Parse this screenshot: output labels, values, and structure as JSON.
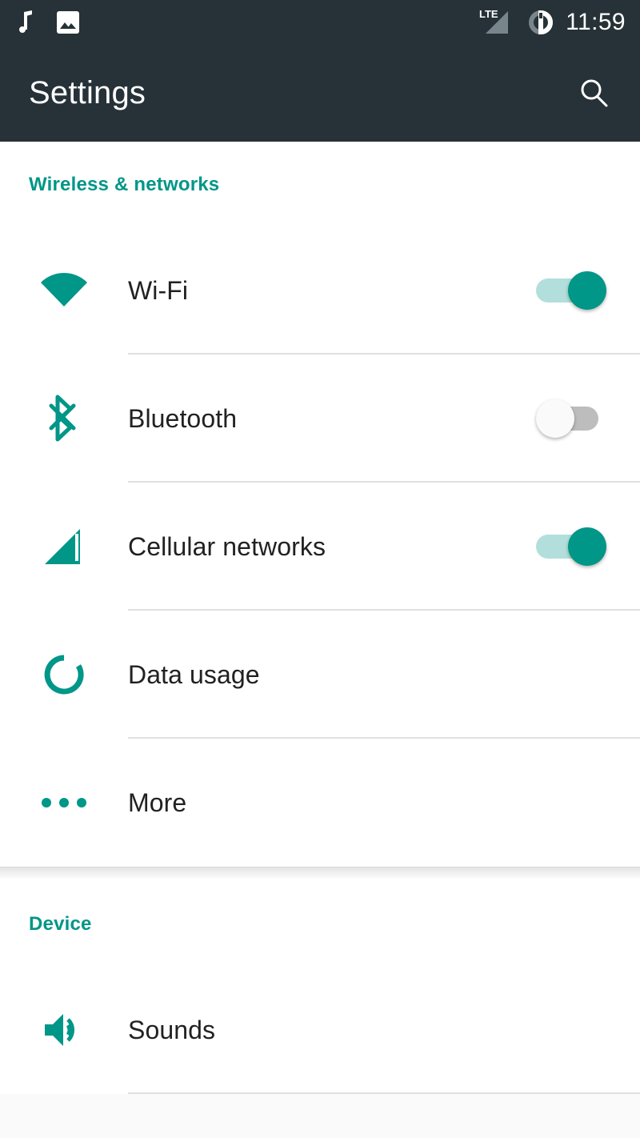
{
  "theme": {
    "accent": "#009688",
    "accent_light": "#b2dfdb",
    "bar_bg": "#263238",
    "text_primary": "#212121",
    "divider": "#e0e0e0",
    "switch_off_track": "#bdbdbd",
    "switch_off_knob": "#fafafa"
  },
  "status_bar": {
    "left_icons": [
      "music-note-icon",
      "image-icon"
    ],
    "network_label": "LTE",
    "signal_icon": "signal-triangle-icon",
    "battery_icon": "battery-circle-icon",
    "time": "11:59"
  },
  "app_bar": {
    "title": "Settings",
    "search_icon": "search-icon"
  },
  "sections": [
    {
      "id": "wireless",
      "header": "Wireless & networks",
      "rows": [
        {
          "id": "wifi",
          "label": "Wi-Fi",
          "icon": "wifi-icon",
          "control": "switch",
          "switch_state": "on",
          "divider": true
        },
        {
          "id": "bluetooth",
          "label": "Bluetooth",
          "icon": "bluetooth-icon",
          "control": "switch",
          "switch_state": "off",
          "divider": true
        },
        {
          "id": "cellular",
          "label": "Cellular networks",
          "icon": "signal-icon",
          "control": "switch",
          "switch_state": "on",
          "divider": true
        },
        {
          "id": "data",
          "label": "Data usage",
          "icon": "data-usage-icon",
          "control": "none",
          "switch_state": "",
          "divider": true
        },
        {
          "id": "more",
          "label": "More",
          "icon": "more-dots-icon",
          "control": "none",
          "switch_state": "",
          "divider": false
        }
      ]
    },
    {
      "id": "device",
      "header": "Device",
      "rows": [
        {
          "id": "sounds",
          "label": "Sounds",
          "icon": "volume-icon",
          "control": "none",
          "switch_state": "",
          "divider": true
        }
      ]
    }
  ]
}
